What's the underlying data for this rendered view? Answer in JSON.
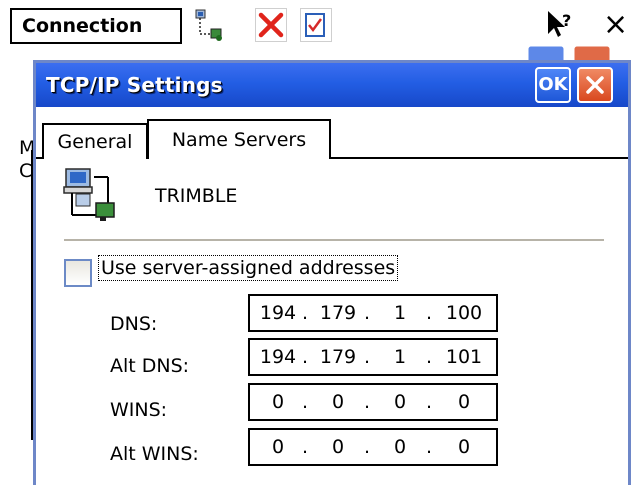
{
  "background": {
    "toolbar": {
      "connection_label": "Connection",
      "icons": [
        "network-settings-icon",
        "delete-icon",
        "accept-icon",
        "help-pointer-icon",
        "close-icon"
      ],
      "close_glyph": "×"
    },
    "left_fragments": [
      "M",
      "C"
    ]
  },
  "dialog": {
    "title": "TCP/IP Settings",
    "ok_label": "OK",
    "tabs": [
      {
        "label": "General",
        "active": false
      },
      {
        "label": "Name Servers",
        "active": true
      }
    ],
    "adapter_name": "TRIMBLE",
    "use_server_assigned": {
      "label": "Use server-assigned addresses",
      "checked": false
    },
    "fields": [
      {
        "label": "DNS:",
        "octets": [
          "194",
          "179",
          "1",
          "100"
        ]
      },
      {
        "label": "Alt DNS:",
        "octets": [
          "194",
          "179",
          "1",
          "101"
        ]
      },
      {
        "label": "WINS:",
        "octets": [
          "0",
          "0",
          "0",
          "0"
        ]
      },
      {
        "label": "Alt WINS:",
        "octets": [
          "0",
          "0",
          "0",
          "0"
        ]
      }
    ],
    "ip_separator": "."
  },
  "colors": {
    "titlebar": "#235ee4",
    "close_button": "#e0542b",
    "ok_button": "#2f6bea"
  }
}
